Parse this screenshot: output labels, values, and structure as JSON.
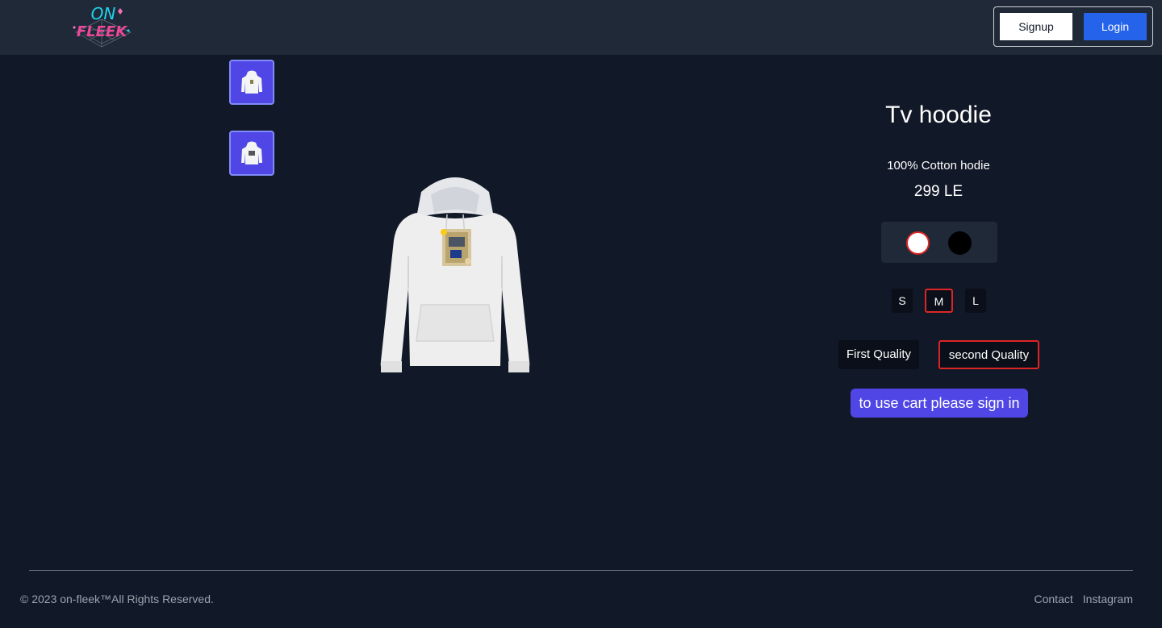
{
  "header": {
    "logo": {
      "line1": "ON",
      "line2": "FLEEK"
    },
    "signup_label": "Signup",
    "login_label": "Login"
  },
  "product": {
    "title": "Tv hoodie",
    "description": "100% Cotton hodie",
    "price": "299 LE",
    "colors": [
      {
        "name": "white",
        "hex": "#ffffff",
        "selected": true
      },
      {
        "name": "black",
        "hex": "#000000",
        "selected": false
      }
    ],
    "sizes": [
      {
        "label": "S",
        "selected": false
      },
      {
        "label": "M",
        "selected": true
      },
      {
        "label": "L",
        "selected": false
      }
    ],
    "qualities": [
      {
        "label": "First Quality",
        "selected": false
      },
      {
        "label": "second Quality",
        "selected": true
      }
    ],
    "cart_label": "to use cart please sign in"
  },
  "footer": {
    "copyright": "© 2023 on-fleek™All Rights Reserved.",
    "links": [
      "Contact",
      "Instagram"
    ]
  },
  "colors": {
    "background": "#111827",
    "navbar": "#1f2937",
    "accent": "#4f46e5",
    "login": "#2563eb",
    "selected_border": "#dc2626"
  }
}
